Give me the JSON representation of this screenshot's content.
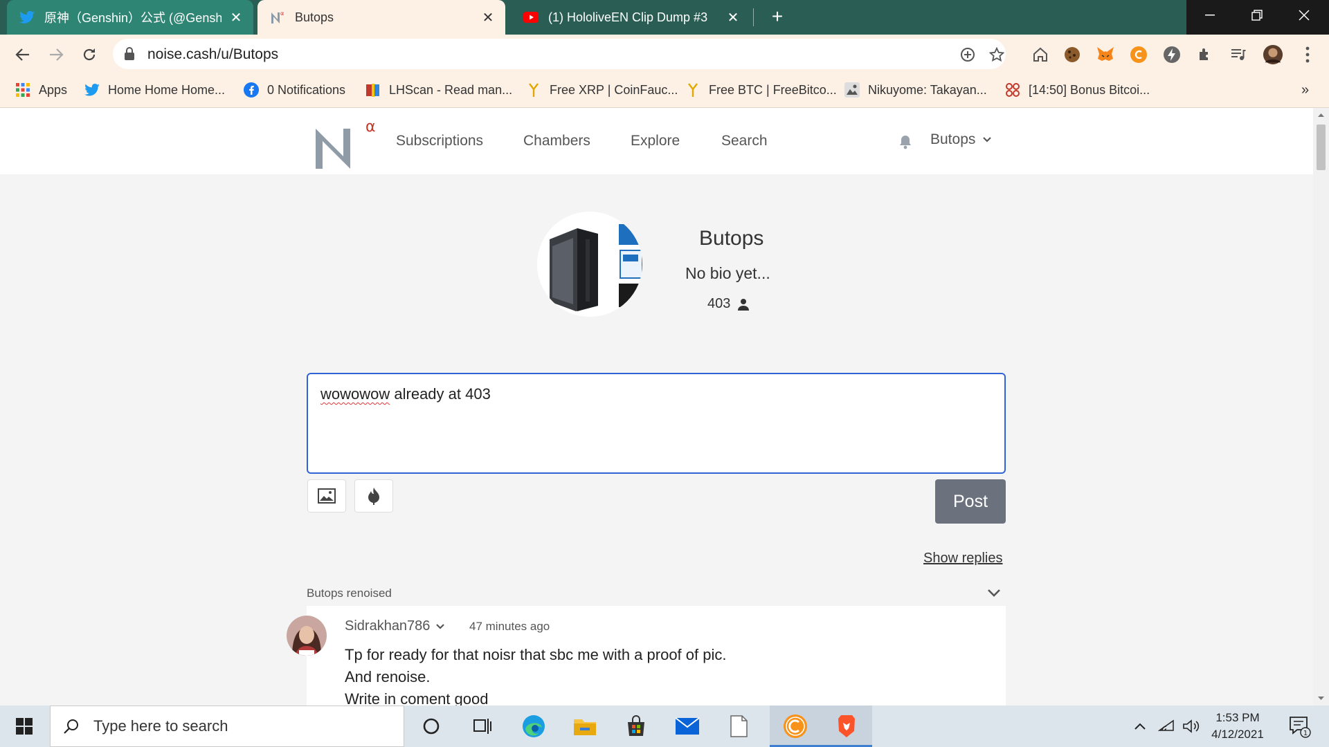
{
  "browser": {
    "tabs": [
      {
        "title": "原神（Genshin）公式 (@Genshin",
        "favicon": "twitter-icon"
      },
      {
        "title": "Butops",
        "favicon": "noise-icon"
      },
      {
        "title": "(1) HololiveEN Clip Dump #3",
        "favicon": "youtube-icon"
      }
    ],
    "url": "noise.cash/u/Butops",
    "bookmarks": [
      {
        "label": "Apps",
        "icon": "apps-grid-icon"
      },
      {
        "label": "Home Home Home...",
        "icon": "twitter-icon"
      },
      {
        "label": "0 Notifications",
        "icon": "facebook-icon"
      },
      {
        "label": "LHScan - Read man...",
        "icon": "book-icon"
      },
      {
        "label": "Free XRP | CoinFauc...",
        "icon": "faucet-icon"
      },
      {
        "label": "Free BTC | FreeBitco...",
        "icon": "faucet-icon"
      },
      {
        "label": "Nikuyome: Takayan...",
        "icon": "manga-icon"
      },
      {
        "label": "[14:50] Bonus Bitcoi...",
        "icon": "bitcoin-icon"
      }
    ],
    "more_bookmarks": "»"
  },
  "site": {
    "nav": [
      "Subscriptions",
      "Chambers",
      "Explore",
      "Search"
    ],
    "logo_text": "N",
    "logo_badge": "α",
    "user": "Butops"
  },
  "profile": {
    "name": "Butops",
    "bio": "No bio yet...",
    "subscribers": "403"
  },
  "composer": {
    "typo_word": "wowowow",
    "rest": " already at 403",
    "post_label": "Post"
  },
  "feed": {
    "show_replies": "Show replies",
    "renoise_label": "Butops renoised",
    "post": {
      "author": "Sidrakhan786",
      "time": "47 minutes ago",
      "lines": [
        "Tp for ready for that noisr that sbc me with a proof of pic.",
        "And renoise.",
        "Write in coment good"
      ]
    }
  },
  "taskbar": {
    "search_placeholder": "Type here to search",
    "time": "1:53 PM",
    "date": "4/12/2021",
    "notification_count": "1"
  },
  "colors": {
    "tab_bar": "#2a5d54",
    "toolbar": "#fdf1e6",
    "composer_border": "#3064d6",
    "post_button": "#6c727d"
  }
}
